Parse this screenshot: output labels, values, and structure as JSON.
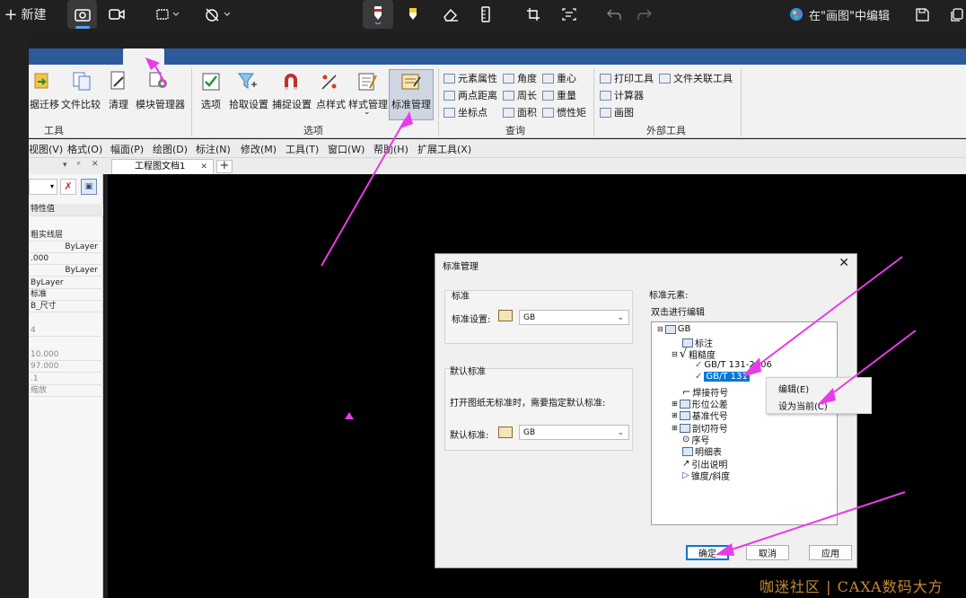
{
  "snip_toolbar": {
    "new_label": "新建",
    "open_in_paint_label": "在\"画图\"中编辑"
  },
  "ribbon": {
    "buttons": [
      "据迁移",
      "文件比较",
      "清理",
      "模块管理器",
      "选项",
      "拾取设置",
      "捕捉设置",
      "点样式",
      "样式管理",
      "标准管理"
    ],
    "query_items": [
      "元素属性",
      "两点距离",
      "坐标点",
      "角度",
      "周长",
      "面积",
      "重心",
      "重量",
      "惯性矩"
    ],
    "external_items": [
      "打印工具",
      "文件关联工具",
      "计算器",
      "画图"
    ],
    "groups": {
      "tools": "工具",
      "options": "选项",
      "query": "查询",
      "external": "外部工具"
    }
  },
  "menu": [
    "视图(V)",
    "格式(O)",
    "幅面(P)",
    "绘图(D)",
    "标注(N)",
    "修改(M)",
    "工具(T)",
    "窗口(W)",
    "帮助(H)",
    "扩展工具(X)"
  ],
  "panel": {
    "header": "特性值",
    "rows": [
      "粗实线层",
      "ByLayer",
      ".000",
      "ByLayer",
      "ByLayer",
      "标准",
      "B_尺寸",
      "4",
      "10.000",
      "97.000",
      ".1",
      "缩放"
    ]
  },
  "doc_tab": "工程图文档1",
  "dialog": {
    "title": "标准管理",
    "standard_group": "标准",
    "standard_setting_label": "标准设置:",
    "standard_value": "GB",
    "default_group": "默认标准",
    "default_hint": "打开图纸无标准时，需要指定默认标准:",
    "default_label": "默认标准:",
    "default_value": "GB",
    "elements_label": "标准元素:",
    "elements_hint": "双击进行编辑",
    "tree": {
      "root": "GB",
      "items": [
        "标注",
        "粗糙度",
        "GB/T 131-2006",
        "GB/T 131",
        "焊接符号",
        "形位公差",
        "基准代号",
        "剖切符号",
        "序号",
        "明细表",
        "引出说明",
        "锥度/斜度"
      ]
    },
    "ok": "确定",
    "cancel": "取消",
    "apply": "应用"
  },
  "context_menu": [
    "编辑(E)",
    "设为当前(C)"
  ],
  "watermark": "咖迷社区 | CAXA数码大方",
  "colors": {
    "arrow": "#e83ae8",
    "selection": "#0078d7",
    "tab_active": "#2d5a9a"
  }
}
